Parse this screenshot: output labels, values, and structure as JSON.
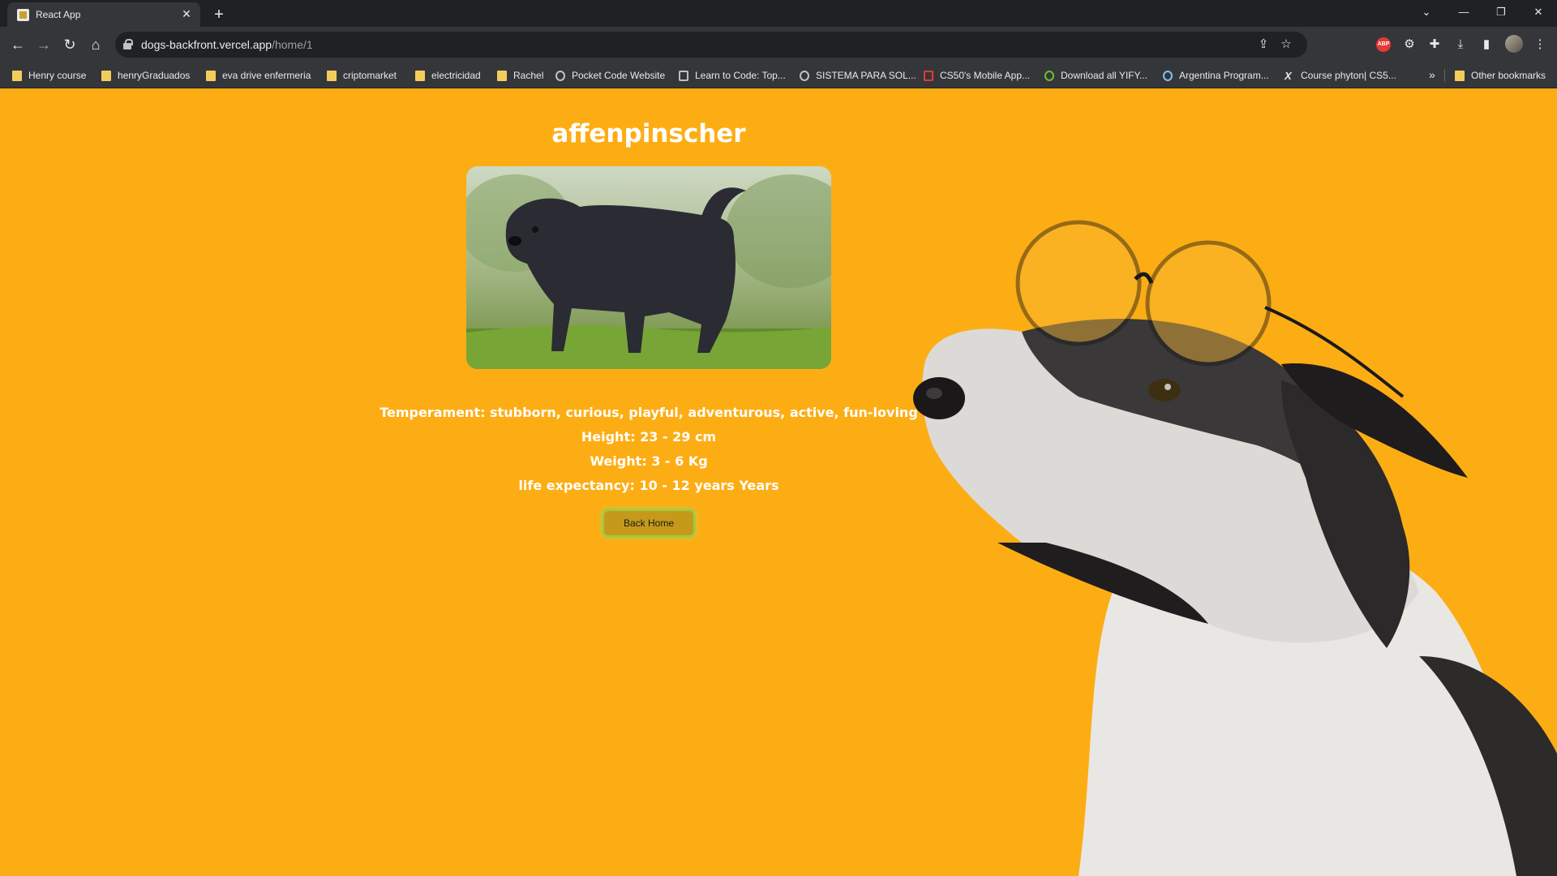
{
  "browser": {
    "tab_title": "React App",
    "tab_close": "✕",
    "new_tab": "+",
    "window_controls": {
      "collapse": "⌄",
      "minimize": "—",
      "restore": "❐",
      "close": "✕"
    },
    "nav": {
      "back": "←",
      "forward": "→",
      "reload": "↻",
      "home": "⌂"
    },
    "url_host": "dogs-backfront.vercel.app",
    "url_path": "/home/1",
    "bookmarks": [
      {
        "label": "Henry course",
        "icon": "folder-icon"
      },
      {
        "label": "henryGraduados",
        "icon": "folder-icon"
      },
      {
        "label": "eva drive enfermeria",
        "icon": "folder-icon"
      },
      {
        "label": "criptomarket",
        "icon": "folder-icon"
      },
      {
        "label": "electricidad",
        "icon": "folder-icon"
      },
      {
        "label": "Rachel",
        "icon": "folder-icon"
      },
      {
        "label": "Pocket Code Website",
        "icon": "site-icon"
      },
      {
        "label": "Learn to Code: Top...",
        "icon": "site-icon"
      },
      {
        "label": "SISTEMA PARA SOL...",
        "icon": "globe-icon"
      },
      {
        "label": "CS50's Mobile App...",
        "icon": "site-icon"
      },
      {
        "label": "Download all YIFY...",
        "icon": "site-icon"
      },
      {
        "label": "Argentina Program...",
        "icon": "site-icon"
      },
      {
        "label": "Course phyton| CS5...",
        "icon": "site-icon"
      }
    ],
    "bookmarks_more": "»",
    "other_bookmarks": "Other bookmarks",
    "extension_abp": "ABP"
  },
  "page": {
    "breed_name": "affenpinscher",
    "temperament": "Temperament: stubborn, curious, playful, adventurous, active, fun-loving",
    "height": "Height: 23 - 29 cm",
    "weight": "Weight: 3 - 6 Kg",
    "life_expectancy": "life expectancy: 10 - 12 years Years",
    "back_button": "Back Home"
  },
  "colors": {
    "background": "#fdad14",
    "button": "#c59a1a",
    "button_border": "#a7c93e",
    "text": "#ffffff"
  }
}
